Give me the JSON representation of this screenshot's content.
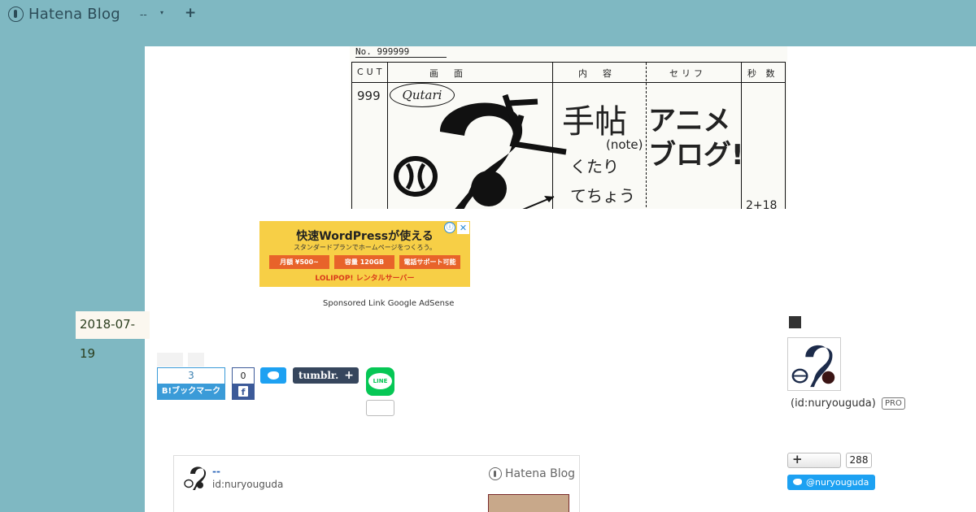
{
  "topbar": {
    "logo_text": "Hatena Blog",
    "blog_select": "--",
    "caret": "▾",
    "add": "+"
  },
  "header_image": {
    "number": "No. 999999",
    "columns": [
      "CUT",
      "画　面",
      "内　容",
      "セリフ",
      "秒 数"
    ],
    "cut_number": "999",
    "qutari": "Qutari",
    "title_big": "手帖",
    "title_note": "(note)",
    "reading_1": "くたり",
    "reading_2": "てちょう",
    "catch_1": "アニメ",
    "catch_2": "ブログ!",
    "seconds": "2+18"
  },
  "ad": {
    "title": "快速WordPressが使える",
    "subtitle": "スタンダードプランでホームページをつくろう。",
    "pills": [
      "月額 ¥500~",
      "容量 120GB",
      "電話サポート可能"
    ],
    "brand": "LOLIPOP! レンタルサーバー",
    "info": "ⓘ",
    "close": "✕",
    "sponsored": "Sponsored Link Google AdSense"
  },
  "post": {
    "date_main": "2018-07-",
    "date_day": "19"
  },
  "share": {
    "hatena_count": "3",
    "hatena_label": "B!ブックマーク",
    "facebook_count": "0",
    "tumblr_label": "tumblr.",
    "tumblr_plus": "+",
    "line_label": "LINE"
  },
  "author_card": {
    "name": "--",
    "id": "id:nuryouguda",
    "logo_text": "Hatena Blog"
  },
  "sidebar": {
    "user_id": "(id:nuryouguda)",
    "pro_badge": "PRO",
    "follow_plus": "+",
    "follower_count": "288",
    "twitter_handle": "@nuryouguda"
  }
}
